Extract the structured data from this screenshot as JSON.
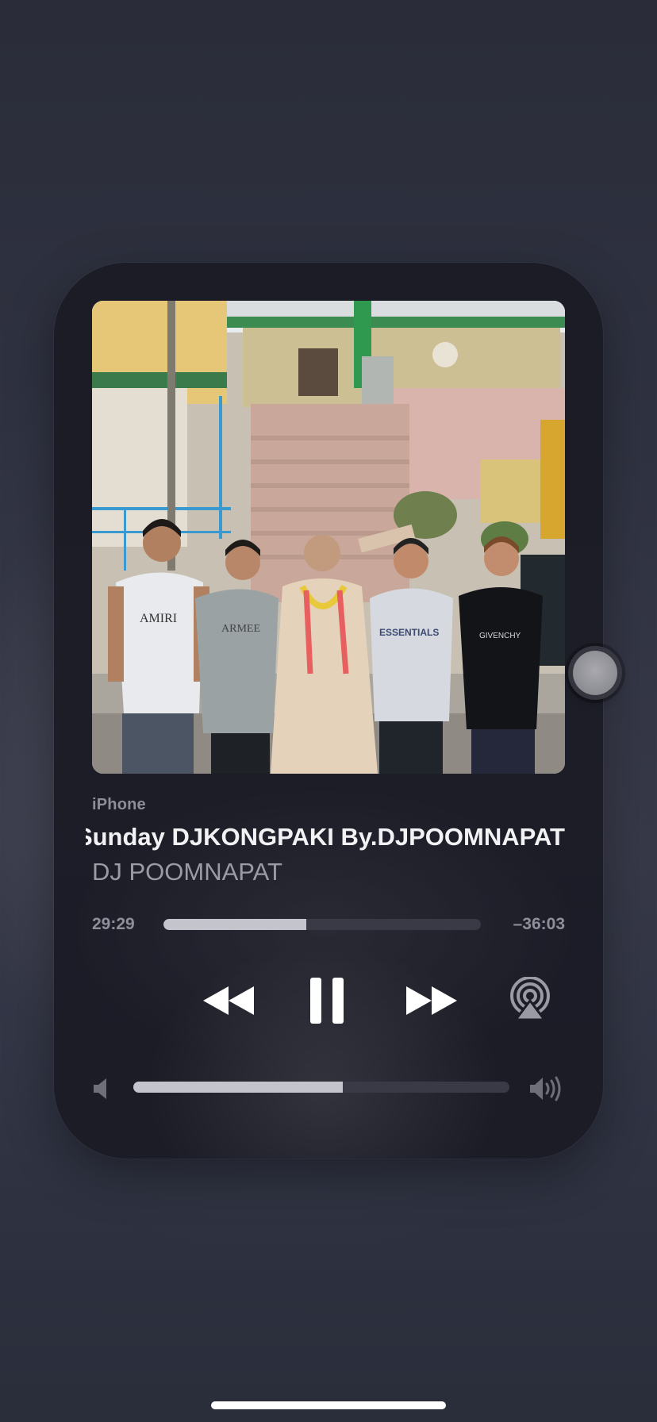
{
  "player": {
    "source": "iPhone",
    "track_title": "Sunday DJKONGPAKI By.DJPOOMNAPAT",
    "artist": "DJ POOMNAPAT",
    "elapsed": "29:29",
    "remaining": "–36:03",
    "progress": 0.45,
    "volume": 0.556,
    "artwork_shirt_texts": [
      "AMIRI",
      "ARMEE",
      "ESSENTIALS",
      "GIVENCHY"
    ]
  },
  "controls": {
    "rewind_icon": "rewind-icon",
    "pause_icon": "pause-icon",
    "forward_icon": "fast-forward-icon",
    "airplay_icon": "airplay-icon",
    "volume_low_icon": "speaker-low-icon",
    "volume_high_icon": "speaker-high-icon"
  },
  "colors": {
    "background": "#2f3241",
    "card": "#1d1d28",
    "accent_fill": "#c4c4cc",
    "track": "#3a3a46"
  }
}
